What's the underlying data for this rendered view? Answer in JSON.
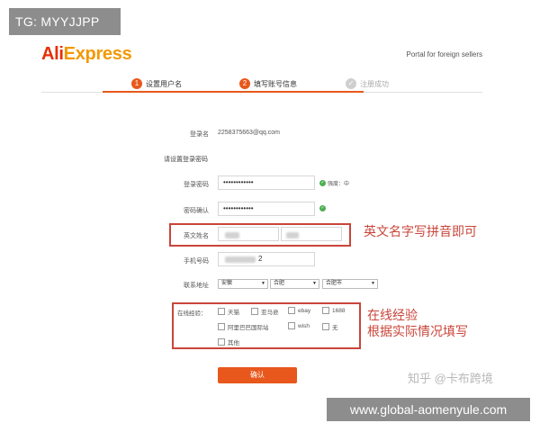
{
  "watermark_top": "TG: MYYJJPP",
  "header": {
    "logo_part1": "Ali",
    "logo_part2": "Express",
    "portal_text": "Portal for foreign sellers"
  },
  "steps": [
    {
      "num": "1",
      "label": "设置用户名"
    },
    {
      "num": "2",
      "label": "填写账号信息"
    },
    {
      "num": "✓",
      "label": "注册成功"
    }
  ],
  "form": {
    "login_name_label": "登录名",
    "login_name_value": "2258375663@qq.com",
    "section_title": "请设置登录密码",
    "password_label": "登录密码",
    "password_value": "••••••••••••",
    "password_strength": "强度：中",
    "confirm_label": "密码确认",
    "confirm_value": "••••••••••••",
    "english_name_label": "英文姓名",
    "phone_label": "手机号码",
    "phone_suffix": "2",
    "address_label": "联系地址",
    "address_province": "安徽",
    "address_city": "合肥",
    "address_district": "合肥市",
    "experience_label": "在线经验：",
    "experience_options": [
      "天猫",
      "亚马逊",
      "ebay",
      "1688",
      "阿里巴巴国际站",
      "wish",
      "无",
      "其他"
    ],
    "submit_label": "确认"
  },
  "annotations": {
    "note1": "英文名字写拼音即可",
    "note2_line1": "在线经验",
    "note2_line2": "根据实际情况填写"
  },
  "watermark_zhihu": "知乎 @卡布跨境",
  "watermark_bottom": "www.global-aomenyule.com",
  "colors": {
    "accent": "#e8581c",
    "annotation_red": "#c9453a",
    "watermark_gray": "#8d8d8d"
  }
}
